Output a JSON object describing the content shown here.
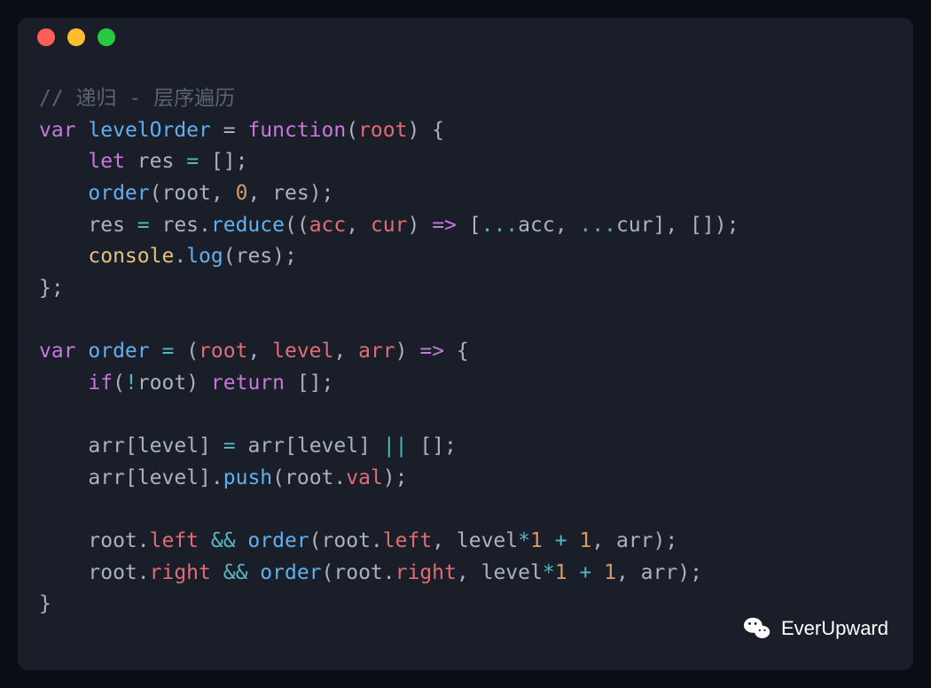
{
  "code": {
    "line1_comment": "// 递归 - 层序遍历",
    "line2_var": "var",
    "line2_name": "levelOrder",
    "line2_eq": " = ",
    "line2_func": "function",
    "line2_paren_open": "(",
    "line2_param": "root",
    "line2_paren_close": ") {",
    "line3_let": "let",
    "line3_res": " res ",
    "line3_eq": "=",
    "line3_arr": " [];",
    "line4_order": "order",
    "line4_paren_open": "(",
    "line4_root": "root",
    "line4_comma1": ", ",
    "line4_zero": "0",
    "line4_comma2": ", ",
    "line4_res": "res",
    "line4_paren_close": ");",
    "line5_res1": "res ",
    "line5_eq": "=",
    "line5_res2": " res",
    "line5_dot": ".",
    "line5_reduce": "reduce",
    "line5_paren_open": "((",
    "line5_acc": "acc",
    "line5_comma1": ", ",
    "line5_cur": "cur",
    "line5_paren_close1": ") ",
    "line5_arrow": "=>",
    "line5_bracket_open": " [",
    "line5_spread1": "...",
    "line5_acc2": "acc",
    "line5_comma2": ", ",
    "line5_spread2": "...",
    "line5_cur2": "cur",
    "line5_bracket_close": "], []);",
    "line6_console": "console",
    "line6_dot": ".",
    "line6_log": "log",
    "line6_paren_open": "(",
    "line6_res": "res",
    "line6_paren_close": ");",
    "line7_close": "};",
    "line9_var": "var",
    "line9_order": " order ",
    "line9_eq": "=",
    "line9_paren_open": " (",
    "line9_root": "root",
    "line9_comma1": ", ",
    "line9_level": "level",
    "line9_comma2": ", ",
    "line9_arr": "arr",
    "line9_paren_close": ") ",
    "line9_arrow": "=>",
    "line9_brace": " {",
    "line10_if": "if",
    "line10_paren_open": "(",
    "line10_not": "!",
    "line10_root": "root",
    "line10_paren_close": ") ",
    "line10_return": "return",
    "line10_arr": " [];",
    "line12_arr1": "arr",
    "line12_bracket1": "[",
    "line12_level1": "level",
    "line12_bracket2": "] ",
    "line12_eq": "=",
    "line12_arr2": " arr",
    "line12_bracket3": "[",
    "line12_level2": "level",
    "line12_bracket4": "] ",
    "line12_or": "||",
    "line12_empty": " [];",
    "line13_arr": "arr",
    "line13_bracket1": "[",
    "line13_level": "level",
    "line13_bracket2": "].",
    "line13_push": "push",
    "line13_paren_open": "(",
    "line13_root": "root",
    "line13_dot": ".",
    "line13_val": "val",
    "line13_paren_close": ");",
    "line15_root1": "root",
    "line15_dot1": ".",
    "line15_left1": "left",
    "line15_and": " && ",
    "line15_order": "order",
    "line15_paren_open": "(",
    "line15_root2": "root",
    "line15_dot2": ".",
    "line15_left2": "left",
    "line15_comma1": ", ",
    "line15_level": "level",
    "line15_mult": "*",
    "line15_one1": "1",
    "line15_plus": " + ",
    "line15_one2": "1",
    "line15_comma2": ", ",
    "line15_arr": "arr",
    "line15_paren_close": ");",
    "line16_root1": "root",
    "line16_dot1": ".",
    "line16_right1": "right",
    "line16_and": " && ",
    "line16_order": "order",
    "line16_paren_open": "(",
    "line16_root2": "root",
    "line16_dot2": ".",
    "line16_right2": "right",
    "line16_comma1": ", ",
    "line16_level": "level",
    "line16_mult": "*",
    "line16_one1": "1",
    "line16_plus": " + ",
    "line16_one2": "1",
    "line16_comma2": ", ",
    "line16_arr": "arr",
    "line16_paren_close": ");",
    "line17_close": "}"
  },
  "watermark": {
    "text": "EverUpward"
  }
}
